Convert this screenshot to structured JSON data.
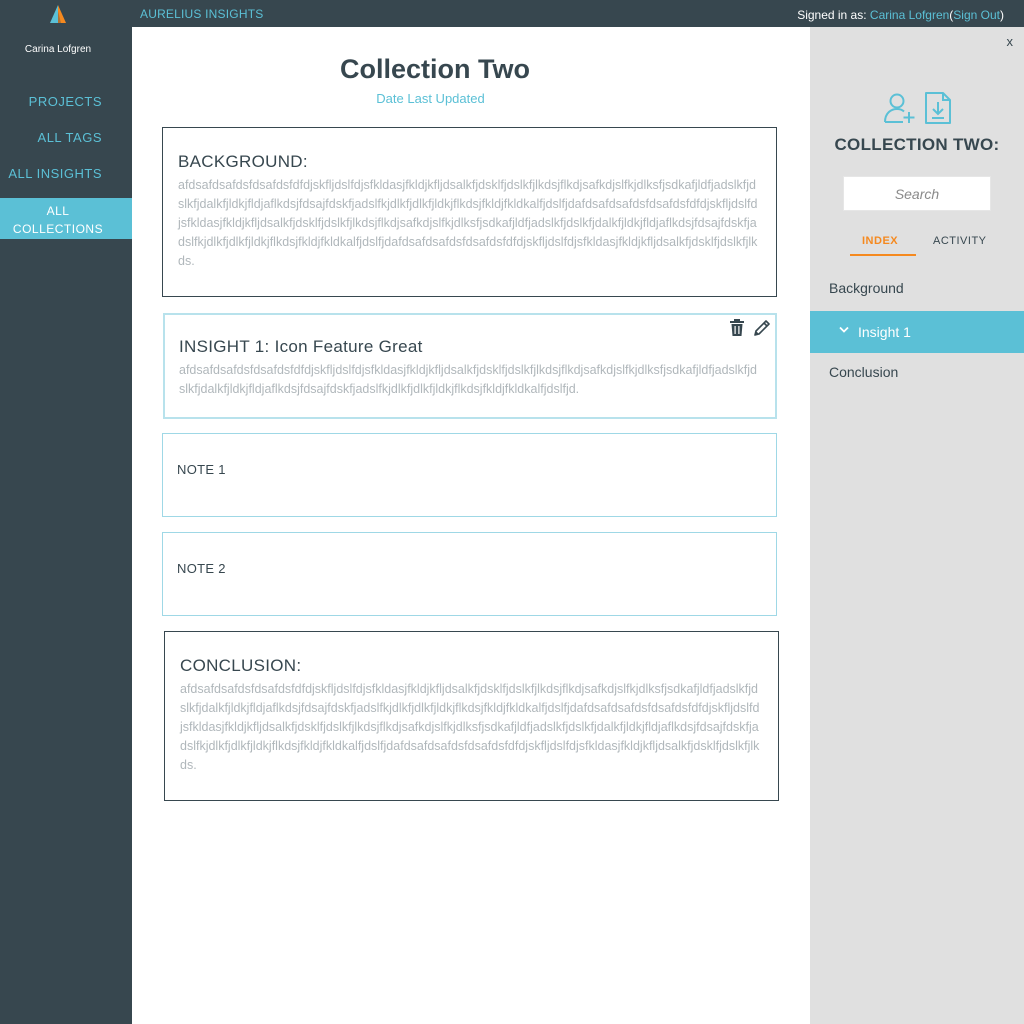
{
  "topbar": {
    "brand": "AURELIUS INSIGHTS",
    "signed_in_prefix": "Signed in as: ",
    "user": "Carina Lofgren",
    "paren_open": "(",
    "sign_out": "Sign Out",
    "paren_close": ")",
    "logo_icon": "aurelius-logo-icon"
  },
  "sidebar": {
    "user_name": "Carina Lofgren",
    "items": [
      {
        "label": "PROJECTS"
      },
      {
        "label": "ALL TAGS"
      },
      {
        "label": "ALL INSIGHTS"
      },
      {
        "label_line1": "ALL",
        "label_line2": "COLLECTIONS",
        "active": true
      }
    ]
  },
  "main": {
    "title": "Collection Two",
    "subtitle": "Date Last Updated",
    "background": {
      "heading": "BACKGROUND:",
      "body": "afdsafdsafdsfdsafdsfdfdjskfljdslfdjsfkldasjfkldjkfljdsalkfjdsklfjdslkfjlkdsjflkdjsafkdjslfkjdlksfjsdkafjldfjadslkfjdslkfjdalkfjldkjfldjaflkdsjfdsajfdskfjadslfkjdlkfjdlkfjldkjflkdsjfkldjfkldkalfjdslfjdafdsafdsafdsfdsafdsfdfdjskfljdslfdjsfkldasjfkldjkfljdsalkfjdsklfjdslkfjlkdsjflkdjsafkdjslfkjdlksfjsdkafjldfjadslkfjdslkfjdalkfjldkjfldjaflkdsjfdsajfdskfjadslfkjdlkfjdlkfjldkjflkdsjfkldjfkldkalfjdslfjdafdsafdsafdsfdsafdsfdfdjskfljdslfdjsfkldasjfkldjkfljdsalkfjdsklfjdslkfjlkds."
    },
    "insight": {
      "heading": "INSIGHT 1: Icon Feature Great",
      "body": "afdsafdsafdsfdsafdsfdfdjskfljdslfdjsfkldasjfkldjkfljdsalkfjdsklfjdslkfjlkdsjflkdjsafkdjslfkjdlksfjsdkafjldfjadslkfjdslkfjdalkfjldkjfldjaflkdsjfdsajfdskfjadslfkjdlkfjdlkfjldkjflkdsjfkldjfkldkalfjdslfjd.",
      "delete_icon": "trash-icon",
      "edit_icon": "pencil-icon"
    },
    "note1": {
      "heading": "NOTE 1"
    },
    "note2": {
      "heading": "NOTE 2"
    },
    "conclusion": {
      "heading": "CONCLUSION:",
      "body": "afdsafdsafdsfdsafdsfdfdjskfljdslfdjsfkldasjfkldjkfljdsalkfjdsklfjdslkfjlkdsjflkdjsafkdjslfkjdlksfjsdkafjldfjadslkfjdslkfjdalkfjldkjfldjaflkdsjfdsajfdskfjadslfkjdlkfjdlkfjldkjflkdsjfkldjfkldkalfjdslfjdafdsafdsafdsfdsafdsfdfdjskfljdslfdjsfkldasjfkldjkfljdsalkfjdsklfjdslkfjlkdsjflkdjsafkdjslfkjdlksfjsdkafjldfjadslkfjdslkfjdalkfjldkjfldjaflkdsjfdsajfdskfjadslfkjdlkfjdlkfjldkjflkdsjfkldjfkldkalfjdslfjdafdsafdsafdsfdsafdsfdfdjskfljdslfdjsfkldasjfkldjkfljdsalkfjdsklfjdslkfjlkds."
    }
  },
  "rpanel": {
    "close": "x",
    "add_user_icon": "add-user-icon",
    "download_icon": "download-icon",
    "title": "COLLECTION TWO:",
    "search_placeholder": "Search",
    "tabs": [
      {
        "label": "INDEX",
        "active": true
      },
      {
        "label": "ACTIVITY"
      }
    ],
    "index_items": [
      {
        "label": "Background"
      },
      {
        "label": "Insight 1",
        "active": true
      },
      {
        "label": "Conclusion"
      }
    ]
  },
  "colors": {
    "dark": "#37474f",
    "accent": "#5bc0d6",
    "orange": "#f5891f",
    "panel": "#e0e0e0"
  }
}
